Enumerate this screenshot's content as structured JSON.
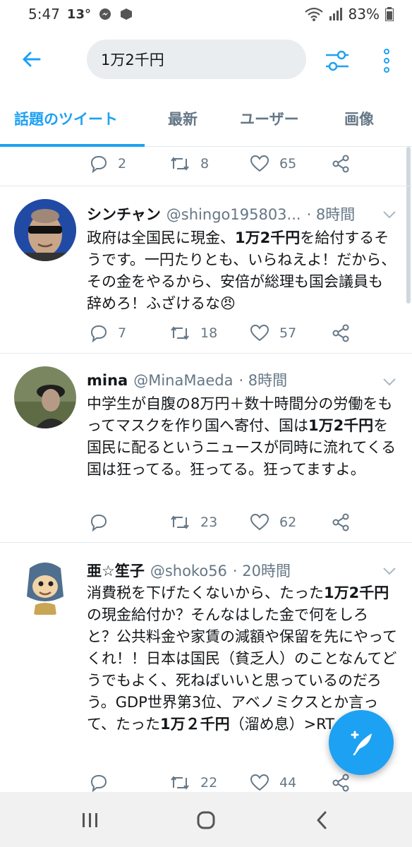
{
  "status_bar": {
    "time": "5:47",
    "temp": "13°",
    "battery": "83%"
  },
  "search": {
    "query": "1万2千円"
  },
  "tabs": [
    {
      "label": "話題のツイート"
    },
    {
      "label": "最新"
    },
    {
      "label": "ユーザー"
    },
    {
      "label": "画像"
    }
  ],
  "prev_tweet": {
    "replies": "2",
    "retweets": "8",
    "likes": "65"
  },
  "tweets": [
    {
      "name": "シンチャン",
      "handle": "@shingo195803...",
      "time": "· 8時間",
      "body": [
        [
          "政府は全国民に現金、",
          "1万2千円",
          "を給付するそうです。一円たりとも、いらねえよ！だから、その金をやるから、安倍が総理も国会議員も辞めろ！ふざけるな😠"
        ]
      ],
      "replies": "7",
      "retweets": "18",
      "likes": "57"
    },
    {
      "name": "mina",
      "handle": "@MinaMaeda",
      "time": "· 8時間",
      "body": [
        [
          "中学生が自腹の8万円＋数十時間分の労働をもってマスクを作り国へ寄付、国は",
          "1万2千円",
          "を国民に配るというニュースが同時に流れてくる国は狂ってる。狂ってる。狂ってますよ。"
        ]
      ],
      "replies": "",
      "retweets": "23",
      "likes": "62"
    },
    {
      "name": "亜☆笙子",
      "handle": "@shoko56",
      "time": "· 20時間",
      "body": [
        [
          "消費税を下げたくないから、たった",
          "1万2千円",
          "の現金給付か？そんなはした金で何をしろと？公共料金や家賃の減額や保留を先にやってくれ！！日本は国民（貧乏人）のことなんてどうでもよく、死ねばいいと思っているのだろう。GDP世界第3位、アベノミクスとか言って、たった",
          "1万２千円",
          "（溜め息）>RT"
        ]
      ],
      "replies": "",
      "retweets": "22",
      "likes": "44"
    }
  ],
  "colors": {
    "accent": "#1da1f2",
    "muted": "#657786",
    "text": "#14171a"
  }
}
